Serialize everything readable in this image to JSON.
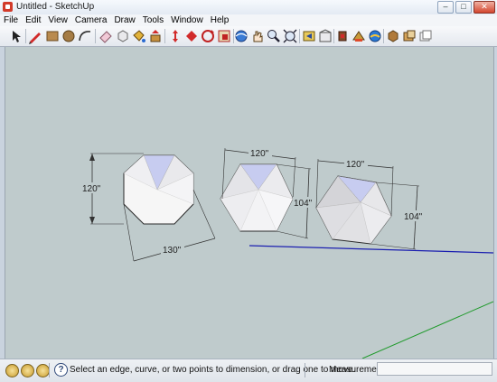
{
  "window": {
    "title": "Untitled - SketchUp",
    "controls": [
      "–",
      "□",
      "✕"
    ]
  },
  "menu": {
    "items": [
      "File",
      "Edit",
      "View",
      "Camera",
      "Draw",
      "Tools",
      "Window",
      "Help"
    ]
  },
  "toolbar": {
    "tools": [
      "select-icon",
      "pencil-icon",
      "rectangle-icon",
      "circle-icon",
      "arc-icon",
      "eraser-icon",
      "paint-bucket-icon",
      "make-component-icon",
      "push-pull-icon",
      "move-icon",
      "rotate-icon",
      "offset-icon",
      "orbit-icon",
      "pan-icon",
      "zoom-icon",
      "zoom-extents-icon",
      "previous-view-icon",
      "3d-warehouse-icon",
      "share-model-icon",
      "get-models-icon",
      "extension-warehouse-icon",
      "layout-icon",
      "component-icon",
      "sandbox-icon"
    ]
  },
  "viewport": {
    "colors": {
      "background": "#bfcbcc",
      "axis_blue": "#1b1fb0",
      "axis_green": "#1e9a2a",
      "face_light": "#f3f3f3",
      "face_selected": "#c7ccf0",
      "edge": "#2a2a2a"
    },
    "dimensions": [
      {
        "label": "120\""
      },
      {
        "label": "130\""
      },
      {
        "label": "120\""
      },
      {
        "label": "104\""
      },
      {
        "label": "120\""
      },
      {
        "label": "104\""
      }
    ]
  },
  "status": {
    "icons": [
      "geolocation-icon",
      "credits-icon",
      "user-icon"
    ],
    "help_icon": "?",
    "message": "Select an edge, curve, or two points to dimension, or drag one to move.",
    "measurements_label": "Measurements",
    "measurements_value": ""
  }
}
